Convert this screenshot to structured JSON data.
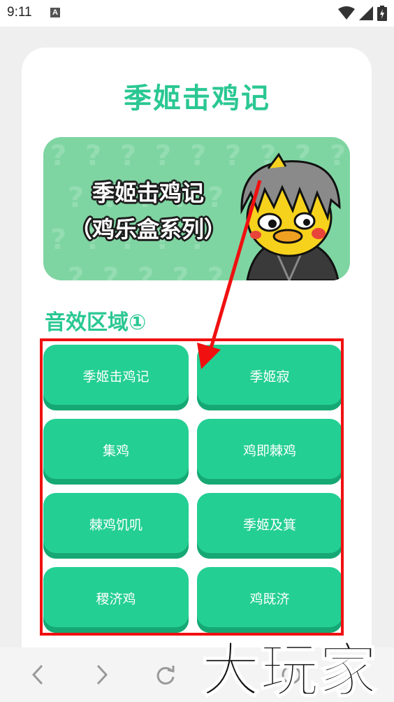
{
  "status_bar": {
    "time": "9:11",
    "notification_icon": "A"
  },
  "page": {
    "title": "季姬击鸡记",
    "banner": {
      "line1": "季姬击鸡记",
      "line2": "（鸡乐盒系列）",
      "mascot": "gray-haired-yellow-chick-mascot"
    },
    "section_title": "音效区域①",
    "sound_buttons": [
      {
        "label": "季姬击鸡记"
      },
      {
        "label": "季姬寂"
      },
      {
        "label": "集鸡"
      },
      {
        "label": "鸡即棘鸡"
      },
      {
        "label": "棘鸡饥叽"
      },
      {
        "label": "季姬及箕"
      },
      {
        "label": "稷济鸡"
      },
      {
        "label": "鸡既济"
      }
    ]
  },
  "annotation": {
    "highlight_color": "#f01010"
  },
  "browser_nav": {
    "back_icon": "chevron-left-icon",
    "forward_icon": "chevron-right-icon",
    "reload_icon": "reload-icon",
    "home_icon": "home-icon",
    "menu_icon": "circle-icon"
  },
  "watermark": {
    "text": "大玩家"
  },
  "colors": {
    "accent": "#2ac793",
    "button": "#24cf94",
    "button_shadow": "#16a874",
    "banner_bg": "#7fd5a2"
  }
}
